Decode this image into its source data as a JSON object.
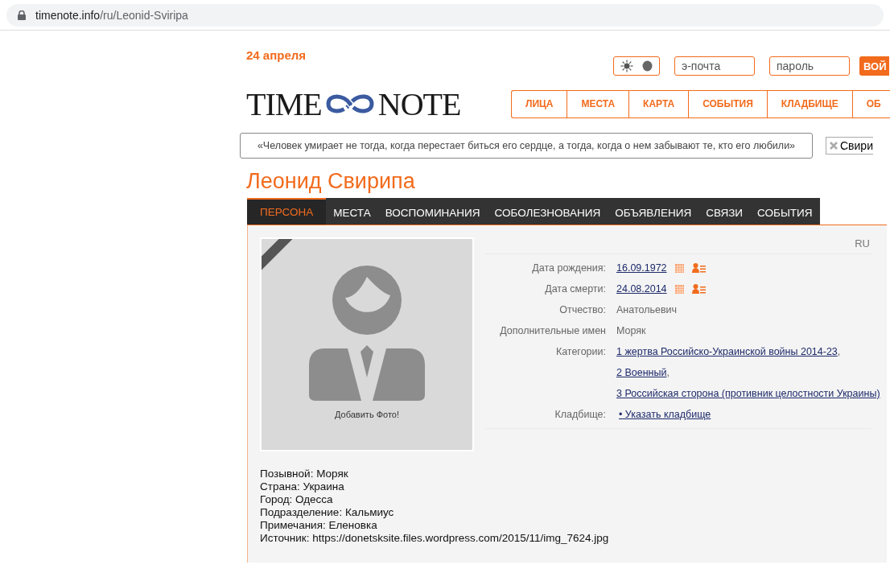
{
  "address_bar": {
    "host": "timenote.info",
    "path": "/ru/Leonid-Sviripa"
  },
  "date": "24 апреля",
  "login": {
    "email_placeholder": "э-почта",
    "password_placeholder": "пароль",
    "button": "ВОЙ"
  },
  "theme_toggle": {
    "on": true
  },
  "logo": {
    "left": "TIME",
    "right": "NOTE"
  },
  "nav": [
    "ЛИЦА",
    "МЕСТА",
    "КАРТА",
    "СОБЫТИЯ",
    "КЛАДБИЩЕ",
    "ОБ"
  ],
  "quote": "«Человек умирает не тогда, когда перестает биться его сердце, а тогда, когда о нем забывают те, кто его любили»",
  "search_chip": "Свири",
  "person_name": "Леонид Свирипа",
  "tabs": [
    {
      "label": "ПЕРСОНА",
      "selected": true
    },
    {
      "label": "МЕСТА",
      "selected": false
    },
    {
      "label": "ВОСПОМИНАНИЯ",
      "selected": false
    },
    {
      "label": "СОБОЛЕЗНОВАНИЯ",
      "selected": false
    },
    {
      "label": "ОБЪЯВЛЕНИЯ",
      "selected": false
    },
    {
      "label": "СВЯЗИ",
      "selected": false
    },
    {
      "label": "СОБЫТИЯ",
      "selected": false
    }
  ],
  "language": "RU",
  "photo": {
    "caption": "Добавить Фото!",
    "mourning_ribbon": true
  },
  "details": [
    {
      "kind": "date",
      "label": "Дата рождения:",
      "value": "16.09.1972"
    },
    {
      "kind": "date",
      "label": "Дата смерти:",
      "value": "24.08.2014"
    },
    {
      "kind": "text",
      "label": "Отчество:",
      "value": "Анатольевич"
    },
    {
      "kind": "text",
      "label": "Дополнительные имен",
      "value": "Моряк"
    },
    {
      "kind": "links",
      "label": "Категории:",
      "separator": ",",
      "links": [
        "1 жертва Российско-Украинской войны 2014-23",
        "2 Военный",
        "3 Российская сторона (противник целостности Украины)"
      ]
    },
    {
      "kind": "link",
      "label": "Кладбище:",
      "value": "• Указать кладбище"
    }
  ],
  "notes": [
    "Позывной: Моряк",
    "Страна: Украина",
    "Город: Одесса",
    "Подразделение: Кальмиус",
    "Примечания: Еленовка",
    "Источник: https://donetsksite.files.wordpress.com/2015/11/img_7624.jpg"
  ]
}
